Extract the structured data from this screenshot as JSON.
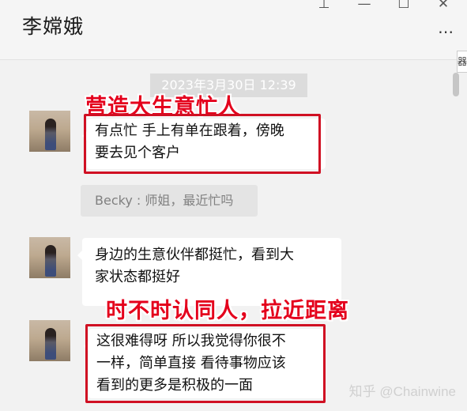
{
  "header": {
    "title": "李嫦娥",
    "controls": {
      "pin": "⊥",
      "minimize": "—",
      "maximize": "☐",
      "close": "✕"
    },
    "more": "⋯",
    "side_peek": "器"
  },
  "chat": {
    "timestamp": "2023年3月30日 12:39",
    "messages": [
      {
        "lines": [
          "有点忙 手上有单在跟着，傍晚",
          "要去见个客户"
        ]
      },
      {
        "lines": [
          "身边的生意伙伴都挺忙，看到大",
          "家状态都挺好"
        ]
      },
      {
        "lines": [
          "这很难得呀 所以我觉得你很不",
          "一样，简单直接 看待事物应该",
          "看到的更多是积极的一面"
        ]
      }
    ],
    "quote": "Becky : 师姐，最近忙吗"
  },
  "annotations": {
    "first": "营造大生意忙人",
    "second": "时不时认同人，拉近距离"
  },
  "watermark": "知乎 @Chainwine",
  "colors": {
    "annotation": "#e4001c",
    "box": "#d01023"
  }
}
